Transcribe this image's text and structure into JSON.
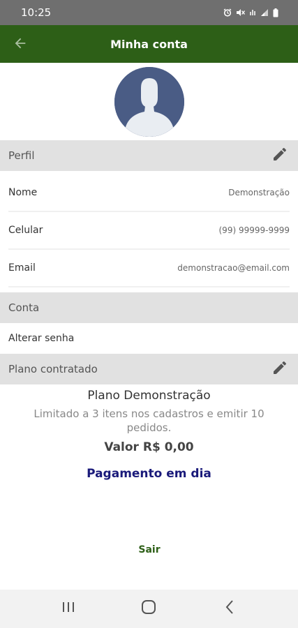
{
  "status_bar": {
    "time": "10:25",
    "icons": [
      "alarm-icon",
      "mute-icon",
      "wifi-icon",
      "signal-icon",
      "battery-icon"
    ],
    "background": "#6f6f6f"
  },
  "app_bar": {
    "title": "Minha conta",
    "back_icon": "arrow-left-icon",
    "background": "#2d5f17"
  },
  "avatar": {
    "icon": "default-user-avatar-icon",
    "background": "#4a5c85"
  },
  "profile": {
    "header": "Perfil",
    "edit_icon": "pencil-icon",
    "fields": [
      {
        "label": "Nome",
        "value": "Demonstração"
      },
      {
        "label": "Celular",
        "value": "(99) 99999-9999"
      },
      {
        "label": "Email",
        "value": "demonstracao@email.com"
      }
    ]
  },
  "account": {
    "header": "Conta",
    "change_password": "Alterar senha"
  },
  "plan": {
    "header": "Plano contratado",
    "edit_icon": "pencil-icon",
    "name": "Plano Demonstração",
    "description": "Limitado a 3 itens nos cadastros e emitir 10 pedidos.",
    "value": "Valor R$ 0,00",
    "payment_status": "Pagamento em dia"
  },
  "logout_label": "Sair",
  "nav_bar": {
    "buttons": [
      "recent-apps-icon",
      "home-icon",
      "back-icon"
    ]
  },
  "colors": {
    "primary": "#2d5f17",
    "section_bg": "#e1e1e1",
    "payment_status": "#1a1a7a"
  }
}
